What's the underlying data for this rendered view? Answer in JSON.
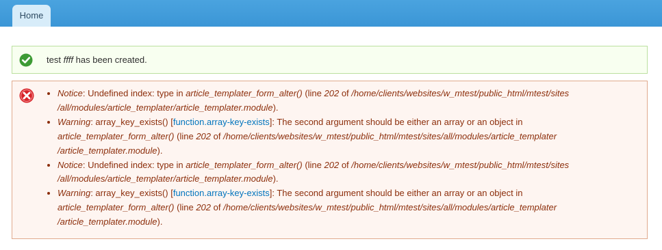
{
  "nav": {
    "home_tab": "Home"
  },
  "status": {
    "prefix": "test ",
    "name": "ffff",
    "suffix": " has been created."
  },
  "errors": [
    {
      "type": "Notice",
      "s1": ": Undefined index: type in ",
      "func": "article_templater_form_alter()",
      "s2": " (line ",
      "line": "202",
      "s3": " of ",
      "path1": "/home/clients/websites/w_mtest/public_html/mtest/sites",
      "path2": "/all/modules/article_templater/article_templater.module",
      "end": ")."
    },
    {
      "type": "Warning",
      "s1": ": array_key_exists() [",
      "link": "function.array-key-exists",
      "s2": "]: The second argument should be either an array or an object in",
      "func": "article_templater_form_alter()",
      "s3": " (line ",
      "line": "202",
      "s4": " of ",
      "path1": "/home/clients/websites/w_mtest/public_html/mtest/sites/all/modules/article_templater",
      "path2": "/article_templater.module",
      "end": ")."
    },
    {
      "type": "Notice",
      "s1": ": Undefined index: type in ",
      "func": "article_templater_form_alter()",
      "s2": " (line ",
      "line": "202",
      "s3": " of ",
      "path1": "/home/clients/websites/w_mtest/public_html/mtest/sites",
      "path2": "/all/modules/article_templater/article_templater.module",
      "end": ")."
    },
    {
      "type": "Warning",
      "s1": ": array_key_exists() [",
      "link": "function.array-key-exists",
      "s2": "]: The second argument should be either an array or an object in",
      "func": "article_templater_form_alter()",
      "s3": " (line ",
      "line": "202",
      "s4": " of ",
      "path1": "/home/clients/websites/w_mtest/public_html/mtest/sites/all/modules/article_templater",
      "path2": "/article_templater.module",
      "end": ")."
    }
  ],
  "colors": {
    "status_border": "#bbe09f",
    "status_bg": "#f8fff0",
    "error_border": "#e0a98d",
    "error_bg": "#fef5f1",
    "error_text": "#8c2e0b",
    "link": "#0074bd"
  }
}
